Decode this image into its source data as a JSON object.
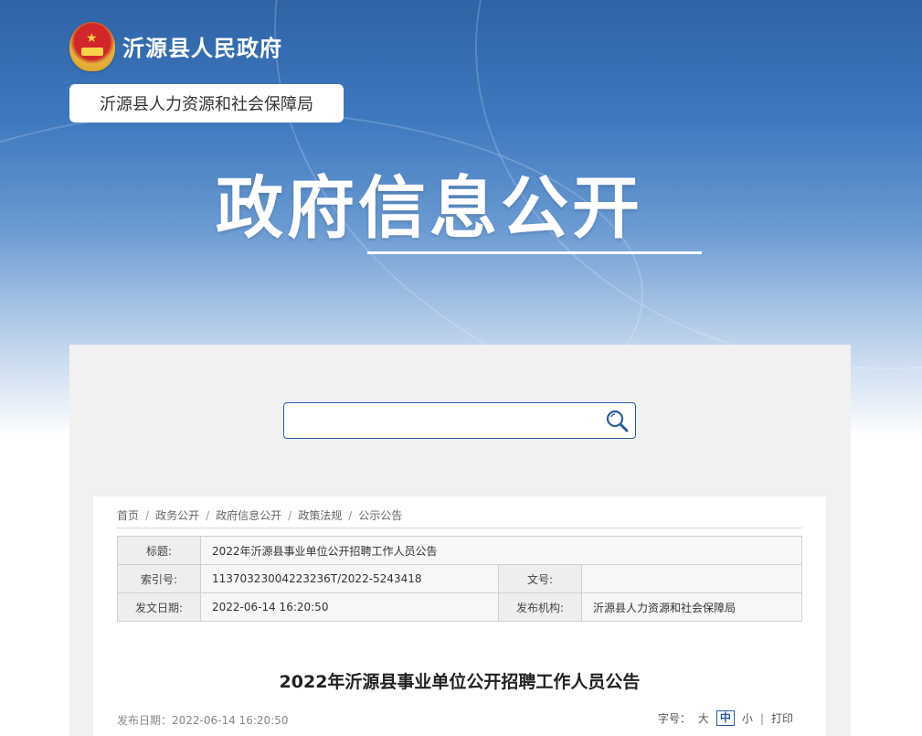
{
  "header": {
    "gov_name": "沂源县人民政府",
    "dept_name": "沂源县人力资源和社会保障局",
    "banner_title": "政府信息公开"
  },
  "search": {
    "placeholder": ""
  },
  "breadcrumb": [
    "首页",
    "政务公开",
    "政府信息公开",
    "政策法规",
    "公示公告"
  ],
  "meta": {
    "title_label": "标题:",
    "title_value": "2022年沂源县事业单位公开招聘工作人员公告",
    "index_label": "索引号:",
    "index_value": "11370323004223236T/2022-5243418",
    "docno_label": "文号:",
    "docno_value": "",
    "date_label": "发文日期:",
    "date_value": "2022-06-14 16:20:50",
    "org_label": "发布机构:",
    "org_value": "沂源县人力资源和社会保障局"
  },
  "article": {
    "title": "2022年沂源县事业单位公开招聘工作人员公告",
    "pub_date": "发布日期：2022-06-14 16:20:50",
    "font_size_label": "字号：",
    "font_large": "大",
    "font_medium": "中",
    "font_small": "小",
    "separator": "|",
    "print": "打印"
  },
  "colors": {
    "accent": "#2c5aa0",
    "banner_top": "#2f63a6"
  }
}
